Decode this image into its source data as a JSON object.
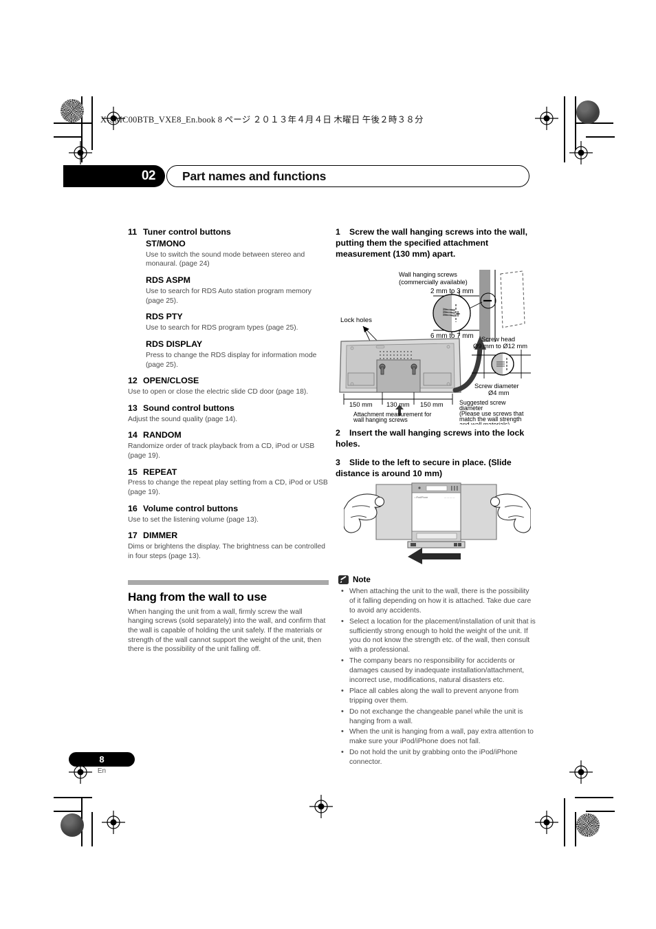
{
  "print_header": "X-SMC00BTB_VXE8_En.book   8 ページ   ２０１３年４月４日   木曜日   午後２時３８分",
  "chapter": {
    "number": "02",
    "title": "Part names and functions"
  },
  "left_column": {
    "items": [
      {
        "num": "11",
        "title": "Tuner control buttons",
        "subtitle": "ST/MONO",
        "body": "Use to switch the sound mode between stereo and monaural. (page 24)"
      },
      {
        "sub": "RDS ASPM",
        "body": "Use to search for RDS Auto station program memory (page 25)."
      },
      {
        "sub": "RDS PTY",
        "body": "Use to search for RDS program types (page 25)."
      },
      {
        "sub": "RDS DISPLAY",
        "body": "Press to change the RDS display for information mode (page 25)."
      },
      {
        "num": "12",
        "title": "OPEN/CLOSE",
        "body": "Use to open or close the electric slide CD door (page 18)."
      },
      {
        "num": "13",
        "title": "Sound control buttons",
        "body": "Adjust the sound quality (page 14)."
      },
      {
        "num": "14",
        "title": "RANDOM",
        "body": "Randomize order of track playback from a CD, iPod or USB (page 19)."
      },
      {
        "num": "15",
        "title": "REPEAT",
        "body": "Press to change the repeat play setting from a CD, iPod or USB (page 19)."
      },
      {
        "num": "16",
        "title": "Volume control buttons",
        "body": "Use to set the listening volume (page 13)."
      },
      {
        "num": "17",
        "title": "DIMMER",
        "body": "Dims or brightens the display. The brightness can be controlled in four steps (page 13)."
      }
    ],
    "section": {
      "title": "Hang from the wall to use",
      "body": "When hanging the unit from a wall, firmly screw the wall hanging screws (sold separately) into the wall, and confirm that the wall is capable of holding the unit safely. If the materials or strength of the wall cannot support the weight of the unit, then there is the possibility of the unit falling off."
    }
  },
  "right_column": {
    "steps": [
      {
        "num": "1",
        "text": "Screw the wall hanging screws into the wall, putting them the specified attachment measurement (130 mm) apart."
      },
      {
        "num": "2",
        "text": "Insert the wall hanging screws into the lock holes."
      },
      {
        "num": "3",
        "text": "Slide to the left to secure in place. (Slide distance is around 10 mm)"
      }
    ],
    "figure1_labels": {
      "wall_screws_line1": "Wall hanging screws",
      "wall_screws_line2": "(commercially available)",
      "depth_top": "2 mm to 3 mm",
      "depth_bottom": "6 mm to 7 mm",
      "lock_holes": "Lock holes",
      "screw_head_line1": "Screw head",
      "screw_head_line2": "Ø9 mm to Ø12 mm",
      "screw_diameter_line1": "Screw diameter",
      "screw_diameter_line2": "Ø4 mm",
      "dim_left": "150 mm",
      "dim_center": "130 mm",
      "dim_right": "150 mm",
      "attachment_line1": "Attachment measurement for",
      "attachment_line2": "wall hanging screws",
      "suggested_line1": "Suggested screw",
      "suggested_line2": "diameter",
      "suggested_line3": "(Please use screws that",
      "suggested_line4": "match the wall strength",
      "suggested_line5": "and wall materials)"
    },
    "note": {
      "title": "Note",
      "items": [
        "When attaching the unit to the wall, there is the possibility of it falling depending on how it is attached. Take due care to avoid any accidents.",
        "Select a location for the placement/installation of unit that is sufficiently strong enough to hold the weight of the unit. If you do not know the strength etc. of the wall, then consult with a professional.",
        "The company bears no responsibility for accidents or damages caused by inadequate installation/attachment, incorrect use, modifications, natural disasters etc.",
        "Place all cables along the wall to prevent anyone from tripping over them.",
        "Do not exchange the changeable panel while the unit is hanging from a wall.",
        "When the unit is hanging from a wall, pay extra attention to make sure your iPod/iPhone does not fall.",
        "Do not hold the unit by grabbing onto the iPod/iPhone connector."
      ]
    }
  },
  "footer": {
    "page_number": "8",
    "language": "En"
  },
  "colors": {
    "accent": "#000000",
    "rule": "#a9a9a9",
    "body_text": "#4a4a4a"
  }
}
